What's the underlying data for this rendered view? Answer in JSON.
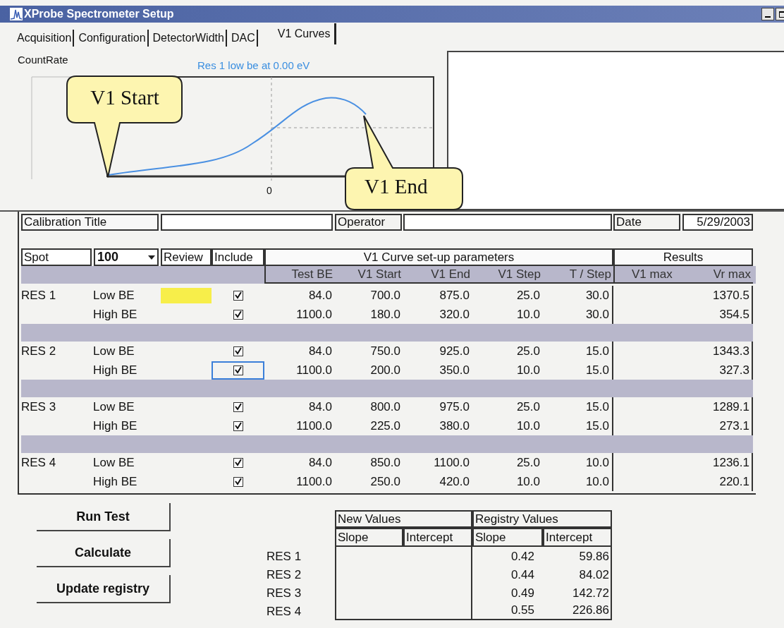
{
  "window": {
    "title": "XProbe Spectrometer Setup"
  },
  "tabs": [
    {
      "label": "Acquisition",
      "selected": false
    },
    {
      "label": "Configuration",
      "selected": false
    },
    {
      "label": "DetectorWidth",
      "selected": false
    },
    {
      "label": "DAC",
      "selected": false
    },
    {
      "label": "V1 Curves",
      "selected": true
    }
  ],
  "chart": {
    "y_label": "CountRate",
    "title": "Res 1 low be at 0.00 eV",
    "x_tick": "0",
    "callouts": [
      "V1 Start",
      "V1 End"
    ]
  },
  "calibration": {
    "title_label": "Calibration Title",
    "operator_label": "Operator",
    "date_label": "Date",
    "date": "5/29/2003"
  },
  "spot": {
    "label": "Spot",
    "value": "100"
  },
  "headers": {
    "review": "Review",
    "include": "Include",
    "group": "V1 Curve set-up parameters",
    "results": "Results",
    "columns": [
      "Test BE",
      "V1 Start",
      "V1 End",
      "V1 Step",
      "T / Step",
      "V1 max",
      "Vr max"
    ]
  },
  "groups": [
    {
      "name": "RES 1",
      "rows": [
        {
          "label": "Low BE",
          "review_marked": true,
          "included": true,
          "focused": false,
          "values": [
            "84.0",
            "700.0",
            "875.0",
            "25.0",
            "30.0"
          ],
          "vr_max": "1370.5"
        },
        {
          "label": "High BE",
          "review_marked": false,
          "included": true,
          "focused": false,
          "values": [
            "1100.0",
            "180.0",
            "320.0",
            "10.0",
            "30.0"
          ],
          "vr_max": "354.5"
        }
      ]
    },
    {
      "name": "RES 2",
      "rows": [
        {
          "label": "Low BE",
          "review_marked": false,
          "included": true,
          "focused": false,
          "values": [
            "84.0",
            "750.0",
            "925.0",
            "25.0",
            "15.0"
          ],
          "vr_max": "1343.3"
        },
        {
          "label": "High BE",
          "review_marked": false,
          "included": true,
          "focused": true,
          "values": [
            "1100.0",
            "200.0",
            "350.0",
            "10.0",
            "15.0"
          ],
          "vr_max": "327.3"
        }
      ]
    },
    {
      "name": "RES 3",
      "rows": [
        {
          "label": "Low BE",
          "review_marked": false,
          "included": true,
          "focused": false,
          "values": [
            "84.0",
            "800.0",
            "975.0",
            "25.0",
            "15.0"
          ],
          "vr_max": "1289.1"
        },
        {
          "label": "High BE",
          "review_marked": false,
          "included": true,
          "focused": false,
          "values": [
            "1100.0",
            "225.0",
            "380.0",
            "10.0",
            "15.0"
          ],
          "vr_max": "273.1"
        }
      ]
    },
    {
      "name": "RES 4",
      "rows": [
        {
          "label": "Low BE",
          "review_marked": false,
          "included": true,
          "focused": false,
          "values": [
            "84.0",
            "850.0",
            "1100.0",
            "25.0",
            "10.0"
          ],
          "vr_max": "1236.1"
        },
        {
          "label": "High BE",
          "review_marked": false,
          "included": true,
          "focused": false,
          "values": [
            "1100.0",
            "250.0",
            "420.0",
            "10.0",
            "10.0"
          ],
          "vr_max": "220.1"
        }
      ]
    }
  ],
  "buttons": [
    "Run Test",
    "Calculate",
    "Update registry"
  ],
  "coefficients": {
    "new_values": "New Values",
    "registry_values": "Registry Values",
    "columns": [
      "Slope",
      "Intercept",
      "Slope",
      "Intercept"
    ],
    "rows": [
      {
        "name": "RES 1",
        "registry_slope": "0.42",
        "registry_intercept": "59.86"
      },
      {
        "name": "RES 2",
        "registry_slope": "0.44",
        "registry_intercept": "84.02"
      },
      {
        "name": "RES 3",
        "registry_slope": "0.49",
        "registry_intercept": "142.72"
      },
      {
        "name": "RES 4",
        "registry_slope": "0.55",
        "registry_intercept": "226.86"
      }
    ]
  }
}
